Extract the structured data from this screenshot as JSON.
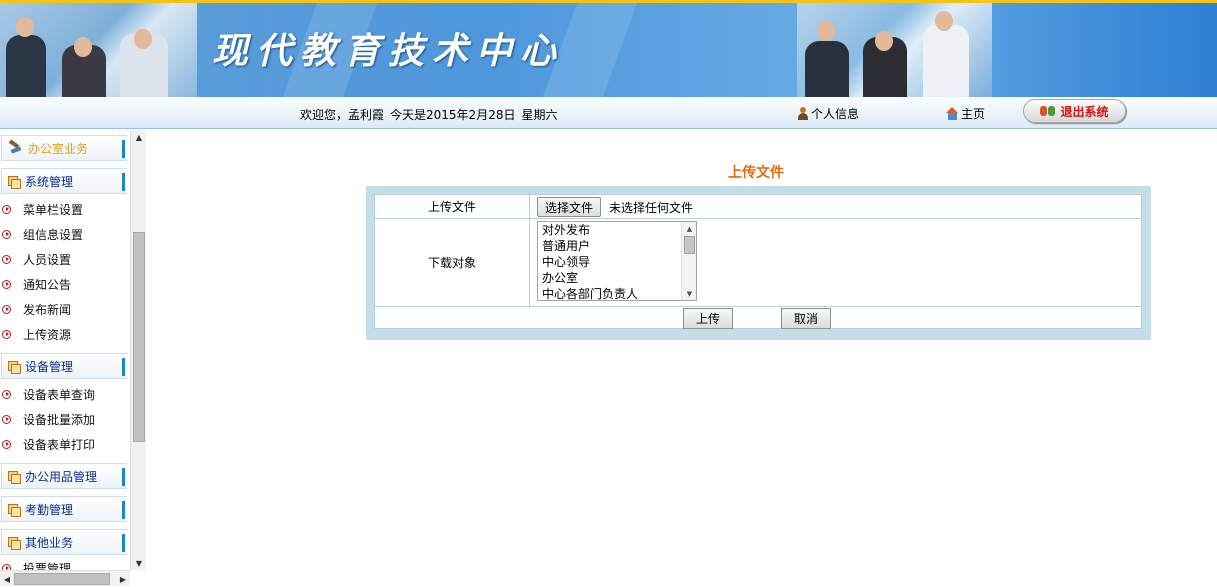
{
  "banner": {
    "title": "现代教育技术中心"
  },
  "infobar": {
    "greeting": "欢迎您，孟利霞",
    "date_text": "今天是2015年2月28日",
    "weekday": "星期六",
    "personal_info": "个人信息",
    "home": "主页",
    "logout": "退出系统"
  },
  "sidebar": {
    "office": "办公室业务",
    "system": "系统管理",
    "system_items": [
      "菜单栏设置",
      "组信息设置",
      "人员设置",
      "通知公告",
      "发布新闻",
      "上传资源"
    ],
    "device": "设备管理",
    "device_items": [
      "设备表单查询",
      "设备批量添加",
      "设备表单打印"
    ],
    "supplies": "办公用品管理",
    "attendance": "考勤管理",
    "other": "其他业务",
    "cut_item": "投票管理"
  },
  "main": {
    "title": "上传文件",
    "upload_label": "上传文件",
    "choose_file": "选择文件",
    "no_file": "未选择任何文件",
    "target_label": "下载对象",
    "targets": [
      "对外发布",
      "普通用户",
      "中心领导",
      "办公室",
      "中心各部门负责人"
    ],
    "upload_button": "上传",
    "cancel_button": "取消"
  }
}
